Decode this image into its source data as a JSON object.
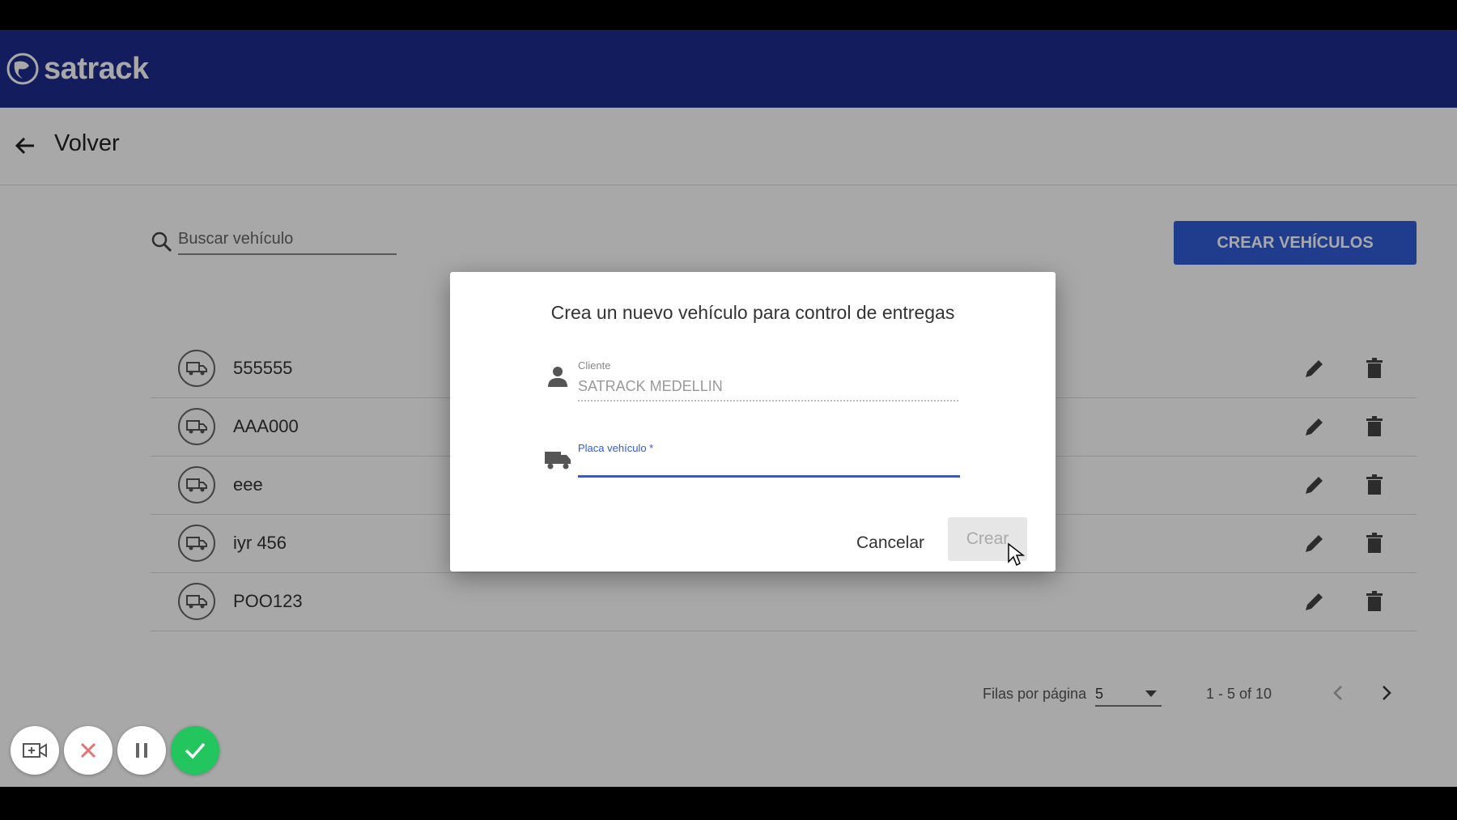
{
  "header": {
    "brand": "satrack",
    "back_label": "Volver"
  },
  "toolbar": {
    "search_placeholder": "Buscar vehículo",
    "create_label": "CREAR VEHÍCULOS"
  },
  "vehicles": [
    {
      "plate": "555555"
    },
    {
      "plate": "AAA000"
    },
    {
      "plate": "eee"
    },
    {
      "plate": "iyr 456"
    },
    {
      "plate": "POO123"
    }
  ],
  "pagination": {
    "rows_label": "Filas por página",
    "rows_value": "5",
    "range": "1 - 5 of 10"
  },
  "dialog": {
    "title": "Crea un nuevo vehículo para control de entregas",
    "client_label": "Cliente",
    "client_value": "SATRACK MEDELLIN",
    "plate_label": "Placa vehículo *",
    "plate_value": "",
    "cancel_label": "Cancelar",
    "submit_label": "Crear"
  },
  "colors": {
    "header_bg": "#1d2d8f",
    "primary": "#2f5bd6",
    "confirm": "#22c55e",
    "stop": "#e57373"
  },
  "icons": {
    "back": "arrow-left-icon",
    "search": "search-icon",
    "row": "truck-icon",
    "edit": "pencil-icon",
    "delete": "trash-icon",
    "client_field": "person-icon",
    "plate_field": "truck-icon",
    "recording": [
      "camera-icon",
      "close-icon",
      "pause-icon",
      "check-icon"
    ]
  }
}
